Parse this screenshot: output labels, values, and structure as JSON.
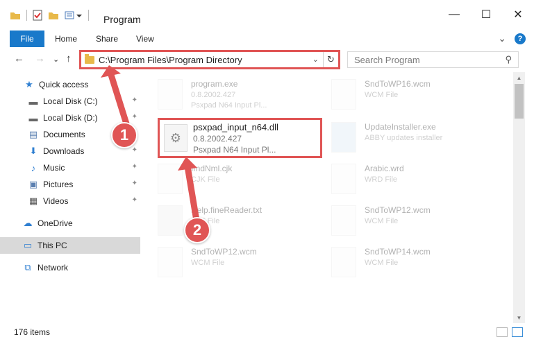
{
  "window": {
    "title": "Program",
    "minimize_glyph": "—",
    "maximize_glyph": "☐",
    "close_glyph": "✕"
  },
  "ribbon": {
    "tabs": [
      "File",
      "Home",
      "Share",
      "View"
    ],
    "collapse_glyph": "⌄",
    "help_glyph": "?"
  },
  "nav": {
    "back_glyph": "←",
    "forward_glyph": "→",
    "recent_glyph": "⌄",
    "up_glyph": "↑"
  },
  "address": {
    "path": "C:\\Program Files\\Program Directory",
    "dropdown_glyph": "⌄",
    "refresh_glyph": "↻"
  },
  "search": {
    "placeholder": "Search Program",
    "icon_glyph": "⚲"
  },
  "sidebar": {
    "items": [
      {
        "label": "Quick access",
        "icon": "star-icon",
        "glyph": "★",
        "pinned": false
      },
      {
        "label": "Local Disk (C:)",
        "icon": "drive-icon",
        "glyph": "▬",
        "pinned": true
      },
      {
        "label": "Local Disk (D:)",
        "icon": "drive-icon",
        "glyph": "▬",
        "pinned": true
      },
      {
        "label": "Documents",
        "icon": "documents-icon",
        "glyph": "▤",
        "pinned": true
      },
      {
        "label": "Downloads",
        "icon": "download-icon",
        "glyph": "⬇",
        "pinned": true
      },
      {
        "label": "Music",
        "icon": "music-icon",
        "glyph": "♪",
        "pinned": true
      },
      {
        "label": "Pictures",
        "icon": "pictures-icon",
        "glyph": "▣",
        "pinned": true
      },
      {
        "label": "Videos",
        "icon": "videos-icon",
        "glyph": "▦",
        "pinned": true
      },
      {
        "label": "OneDrive",
        "icon": "cloud-icon",
        "glyph": "☁",
        "pinned": false
      },
      {
        "label": "This PC",
        "icon": "computer-icon",
        "glyph": "▭",
        "pinned": false
      },
      {
        "label": "Network",
        "icon": "network-icon",
        "glyph": "⧉",
        "pinned": false
      }
    ],
    "pin_glyph": "📌"
  },
  "files": [
    {
      "name": "program.exe",
      "line2": "0.8.2002.427",
      "line3": "Psxpad N64 Input Pl..."
    },
    {
      "name": "SndToWP16.wcm",
      "line2": "WCM File",
      "line3": ""
    },
    {
      "name": "UpdateInstaller.exe",
      "line2": "ABBY updates installer",
      "line3": ""
    },
    {
      "name": "ImdNml.cjk",
      "line2": "CJK File",
      "line3": ""
    },
    {
      "name": "Arabic.wrd",
      "line2": "WRD File",
      "line3": ""
    },
    {
      "name": "Help.fineReader.txt",
      "line2": "TXT File",
      "line3": ""
    },
    {
      "name": "SndToWP12.wcm",
      "line2": "WCM File",
      "line3": ""
    },
    {
      "name": "SndToWP12.wcm",
      "line2": "WCM File",
      "line3": ""
    },
    {
      "name": "SndToWP14.wcm",
      "line2": "WCM File",
      "line3": ""
    }
  ],
  "highlighted_file": {
    "name": "psxpad_input_n64.dll",
    "version": "0.8.2002.427",
    "description": "Psxpad N64 Input Pl...",
    "icon_glyph": "⚙"
  },
  "steps": [
    "1",
    "2"
  ],
  "status": {
    "item_count": "176 items"
  },
  "colors": {
    "accent": "#1979ca",
    "annotation": "#e05555",
    "selected_bg": "#d9d9d9"
  }
}
